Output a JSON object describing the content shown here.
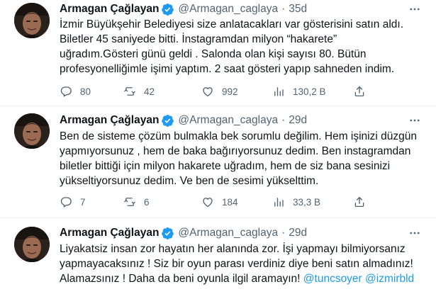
{
  "tweets": [
    {
      "author_name": "Armagan Çağlayan",
      "handle": "@Armagan_caglaya",
      "separator": "·",
      "time": "35d",
      "lines": [
        "İzmir Büyükşehir Belediyesi size anlatacakları var gösterisini satın aldı.",
        "Biletler 45 saniyede bitti. İnstagramdan milyon “hakarete”",
        "uğradım.Gösteri günü geldi . Salonda olan kişi sayısı 80. Bütün",
        "profesyonelliğimle işimi yaptım. 2 saat gösteri yapıp sahneden indim."
      ],
      "stats": {
        "replies": "80",
        "retweets": "42",
        "likes": "992",
        "views": "130,2 B"
      }
    },
    {
      "author_name": "Armagan Çağlayan",
      "handle": "@Armagan_caglaya",
      "separator": "·",
      "time": "29d",
      "lines": [
        "Ben de sisteme çözüm bulmakla bek sorumlu değilim. Hem işinizi düzgün",
        "yapmıyorsunuz , hem de baka bağırıyorsunuz dedim. Ben instagramdan",
        "biletler bittiği için milyon hakarete uğradım, hem de siz bana sesinizi",
        "yükseltiyorsunuz dedim. Ve ben de sesimi yükselttim."
      ],
      "stats": {
        "replies": "7",
        "retweets": "6",
        "likes": "184",
        "views": "33,3 B"
      }
    },
    {
      "author_name": "Armagan Çağlayan",
      "handle": "@Armagan_caglaya",
      "separator": "·",
      "time": "29d",
      "lines": [
        "Liyakatsiz insan zor hayatın her alanında  zor. İşi yapmayı bilmiyorsanız",
        "yapmayacaksınız ! Siz bir oyun parası verdiniz diye beni satın almadınız!",
        "Alamazsınız ! Daha da beni oyunla ilgil aramayın!"
      ],
      "mentions": [
        "@tuncsoyer",
        "@izmirbld"
      ]
    }
  ],
  "colors": {
    "text": "#0f1419",
    "secondary": "#536471",
    "accent": "#1d9bf0",
    "divider": "#eff3f4"
  },
  "icons": {
    "verified": "verified-badge-icon",
    "more": "more-options-icon",
    "reply": "reply-icon",
    "retweet": "retweet-icon",
    "like": "like-icon",
    "views": "views-icon",
    "share": "share-icon"
  }
}
